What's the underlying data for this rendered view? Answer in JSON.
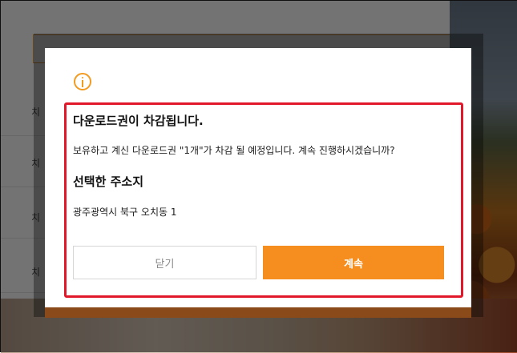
{
  "background": {
    "list_items": [
      "치",
      "치",
      "치",
      "치"
    ]
  },
  "dialog": {
    "icon": "info-icon",
    "title": "다운로드권이 차감됩니다.",
    "message": "보유하고 계신 다운로드권 \"1개\"가 차감 될 예정입니다. 계속 진행하시겠습니까?",
    "address_heading": "선택한 주소지",
    "address": "광주광역시 북구 오치동 1",
    "close_label": "닫기",
    "continue_label": "계속"
  },
  "colors": {
    "accent": "#f58e1f",
    "highlight_border": "#e0182a",
    "icon": "#f39a20"
  }
}
